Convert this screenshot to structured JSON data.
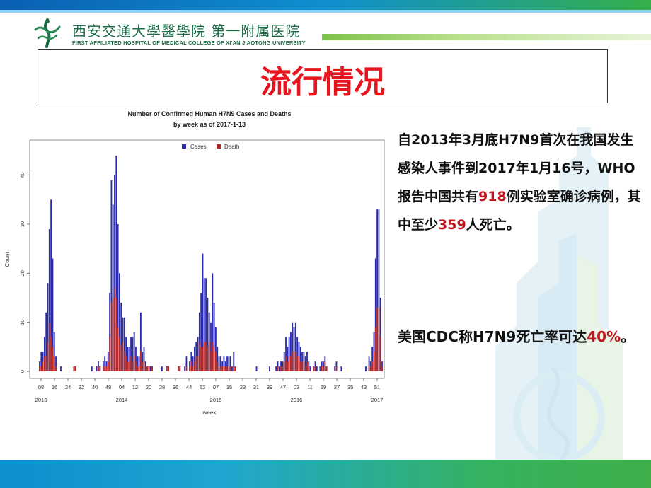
{
  "header": {
    "logo_cn_school": "西安交通大學醫學院",
    "logo_cn_hospital": "第一附属医院",
    "logo_en": "FIRST AFFILIATED HOSPITAL OF MEDICAL COLLEGE OF XI'AN JIAOTONG UNIVERSITY"
  },
  "slide": {
    "title": "流行情况",
    "para1_a": "自2013年3月底H7N9首次在我国发生感染人事件到2017年1月16号，WHO报告中国共有",
    "para1_cases": "918",
    "para1_b": "例实验室确诊病例，其中至少",
    "para1_deaths": "359",
    "para1_c": "人死亡。",
    "para2_a": "美国CDC称H7N9死亡率可达",
    "para2_rate": "40%",
    "para2_b": "。"
  },
  "colors": {
    "title_red": "#e8141e",
    "highlight_red": "#c0161e",
    "cases_blue": "#2b2bb0",
    "death_red": "#b22a2a"
  },
  "chart_data": {
    "type": "bar",
    "title": "Number of Confirmed Human H7N9 Cases and Deaths",
    "subtitle": "by week as of 2017-1-13",
    "xlabel": "week",
    "ylabel": "Count",
    "ylim": [
      0,
      45
    ],
    "yticks": [
      0,
      10,
      20,
      30,
      40
    ],
    "legend_position": "top-center",
    "week_ticks": [
      "08",
      "16",
      "24",
      "32",
      "40",
      "48",
      "04",
      "12",
      "20",
      "28",
      "36",
      "44",
      "52",
      "07",
      "15",
      "23",
      "31",
      "39",
      "47",
      "03",
      "11",
      "19",
      "27",
      "35",
      "43",
      "51"
    ],
    "year_ticks": [
      {
        "label": "2013",
        "tick_index": 0
      },
      {
        "label": "2014",
        "tick_index": 6
      },
      {
        "label": "2015",
        "tick_index": 13
      },
      {
        "label": "2016",
        "tick_index": 19
      },
      {
        "label": "2017",
        "tick_index": 25
      }
    ],
    "series": [
      {
        "name": "Cases",
        "color": "#2b2bb0",
        "values": [
          2,
          4,
          4,
          7,
          12,
          18,
          29,
          35,
          23,
          8,
          3,
          0,
          0,
          1,
          0,
          0,
          0,
          0,
          0,
          0,
          0,
          1,
          1,
          0,
          0,
          0,
          0,
          0,
          0,
          0,
          0,
          0,
          1,
          0,
          0,
          1,
          2,
          1,
          0,
          2,
          3,
          2,
          4,
          16,
          39,
          34,
          40,
          44,
          30,
          20,
          14,
          11,
          11,
          7,
          5,
          5,
          7,
          7,
          8,
          5,
          3,
          3,
          12,
          4,
          5,
          2,
          1,
          1,
          1,
          1,
          0,
          0,
          0,
          0,
          0,
          1,
          0,
          0,
          1,
          1,
          0,
          0,
          0,
          0,
          0,
          1,
          1,
          0,
          0,
          1,
          3,
          0,
          2,
          4,
          3,
          5,
          6,
          7,
          12,
          16,
          24,
          19,
          19,
          15,
          12,
          10,
          20,
          14,
          9,
          5,
          3,
          3,
          2,
          3,
          2,
          3,
          3,
          3,
          1,
          4,
          1,
          0,
          0,
          0,
          0,
          0,
          0,
          0,
          0,
          0,
          0,
          0,
          0,
          1,
          0,
          0,
          0,
          0,
          0,
          0,
          0,
          1,
          0,
          0,
          0,
          1,
          2,
          1,
          2,
          2,
          4,
          7,
          5,
          7,
          8,
          10,
          9,
          10,
          7,
          6,
          5,
          4,
          4,
          3,
          4,
          2,
          1,
          0,
          1,
          2,
          1,
          0,
          1,
          2,
          2,
          3,
          1,
          0,
          0,
          0,
          0,
          1,
          2,
          0,
          0,
          1,
          0,
          0,
          0,
          0,
          0,
          0,
          0,
          0,
          0,
          0,
          0,
          0,
          0,
          0,
          1,
          0,
          3,
          2,
          5,
          8,
          23,
          33,
          33,
          15,
          2
        ]
      },
      {
        "name": "Death",
        "color": "#b22a2a",
        "values": [
          1,
          1,
          2,
          3,
          3,
          6,
          10,
          7,
          5,
          3,
          1,
          0,
          0,
          0,
          0,
          0,
          0,
          0,
          0,
          0,
          0,
          1,
          1,
          0,
          0,
          0,
          0,
          0,
          0,
          0,
          0,
          0,
          0,
          0,
          0,
          0,
          1,
          1,
          0,
          1,
          1,
          1,
          2,
          7,
          14,
          15,
          17,
          15,
          9,
          7,
          5,
          6,
          4,
          3,
          2,
          2,
          3,
          2,
          3,
          2,
          1,
          1,
          4,
          2,
          2,
          1,
          1,
          1,
          0,
          1,
          0,
          0,
          0,
          0,
          0,
          0,
          0,
          0,
          1,
          1,
          0,
          0,
          0,
          0,
          0,
          1,
          1,
          0,
          0,
          0,
          1,
          0,
          1,
          2,
          1,
          2,
          3,
          3,
          6,
          5,
          5,
          6,
          6,
          5,
          6,
          4,
          6,
          5,
          4,
          2,
          1,
          1,
          1,
          1,
          1,
          1,
          1,
          1,
          0,
          1,
          1,
          0,
          0,
          0,
          0,
          0,
          0,
          0,
          0,
          0,
          0,
          0,
          0,
          0,
          0,
          0,
          0,
          0,
          0,
          0,
          0,
          0,
          0,
          0,
          0,
          0,
          1,
          0,
          1,
          1,
          2,
          3,
          2,
          3,
          3,
          4,
          4,
          4,
          3,
          3,
          2,
          2,
          2,
          1,
          2,
          1,
          0,
          0,
          1,
          1,
          0,
          0,
          0,
          1,
          1,
          2,
          1,
          0,
          0,
          0,
          0,
          0,
          1,
          0,
          0,
          0,
          0,
          0,
          0,
          0,
          0,
          0,
          0,
          0,
          0,
          0,
          0,
          0,
          0,
          0,
          0,
          0,
          1,
          1,
          2,
          4,
          9,
          13,
          13,
          7,
          1
        ]
      }
    ]
  }
}
